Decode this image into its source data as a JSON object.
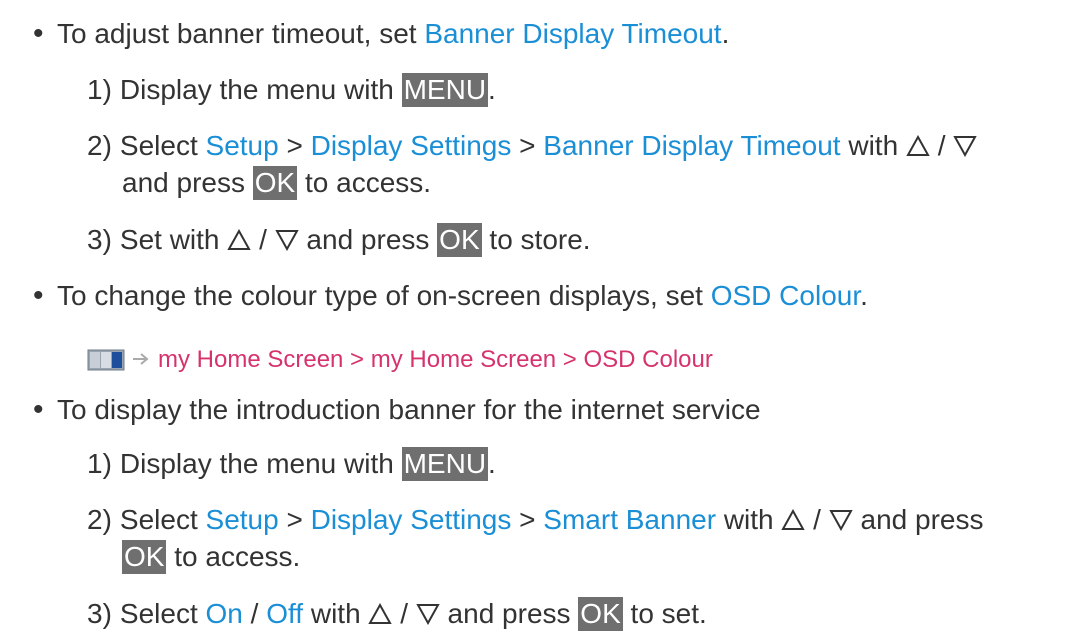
{
  "section1": {
    "bullet": "•",
    "text": "To adjust banner timeout, set ",
    "link": "Banner Display Timeout",
    "period": "."
  },
  "s1_step1": {
    "num": "1)",
    "text": "Display the menu with ",
    "key": "MENU",
    "period": "."
  },
  "s1_step2": {
    "num": "2)",
    "text": "Select ",
    "link1": "Setup",
    "sep1": " > ",
    "link2": "Display Settings",
    "sep2": " > ",
    "link3": "Banner Display Timeout",
    "text2": " with ",
    "slash": " / ",
    "line2_pre": "and press ",
    "key": "OK",
    "line2_post": " to access."
  },
  "s1_step3": {
    "num": "3)",
    "text": "Set with ",
    "slash": " / ",
    "text2": " and press ",
    "key": "OK",
    "post": " to store."
  },
  "section2": {
    "bullet": "•",
    "text": "To change the colour type of on-screen displays, set ",
    "link": "OSD Colour",
    "period": "."
  },
  "nav_path": {
    "text": "my Home Screen > my Home Screen > OSD Colour"
  },
  "section3": {
    "bullet": "•",
    "text": "To display the introduction banner for the internet service"
  },
  "s3_step1": {
    "num": "1)",
    "text": "Display the menu with ",
    "key": "MENU",
    "period": "."
  },
  "s3_step2": {
    "num": "2)",
    "text": "Select ",
    "link1": "Setup",
    "sep1": " > ",
    "link2": "Display Settings",
    "sep2": " > ",
    "link3": "Smart Banner",
    "text2": " with ",
    "slash": " / ",
    "text3": " and press",
    "key": "OK",
    "line2_post": " to access."
  },
  "s3_step3": {
    "num": "3)",
    "text": "Select ",
    "link1": "On",
    "slash1": " / ",
    "link2": "Off",
    "text2": " with ",
    "slash2": " / ",
    "text3": " and press ",
    "key": "OK",
    "post": " to set."
  },
  "colors": {
    "link": "#1b8fd6",
    "nav_path": "#d6336c",
    "key_bg": "#6f6f6f",
    "text": "#333333"
  },
  "icons": [
    "up-triangle-icon",
    "down-triangle-icon",
    "home-screen-icon",
    "right-arrow-icon"
  ]
}
